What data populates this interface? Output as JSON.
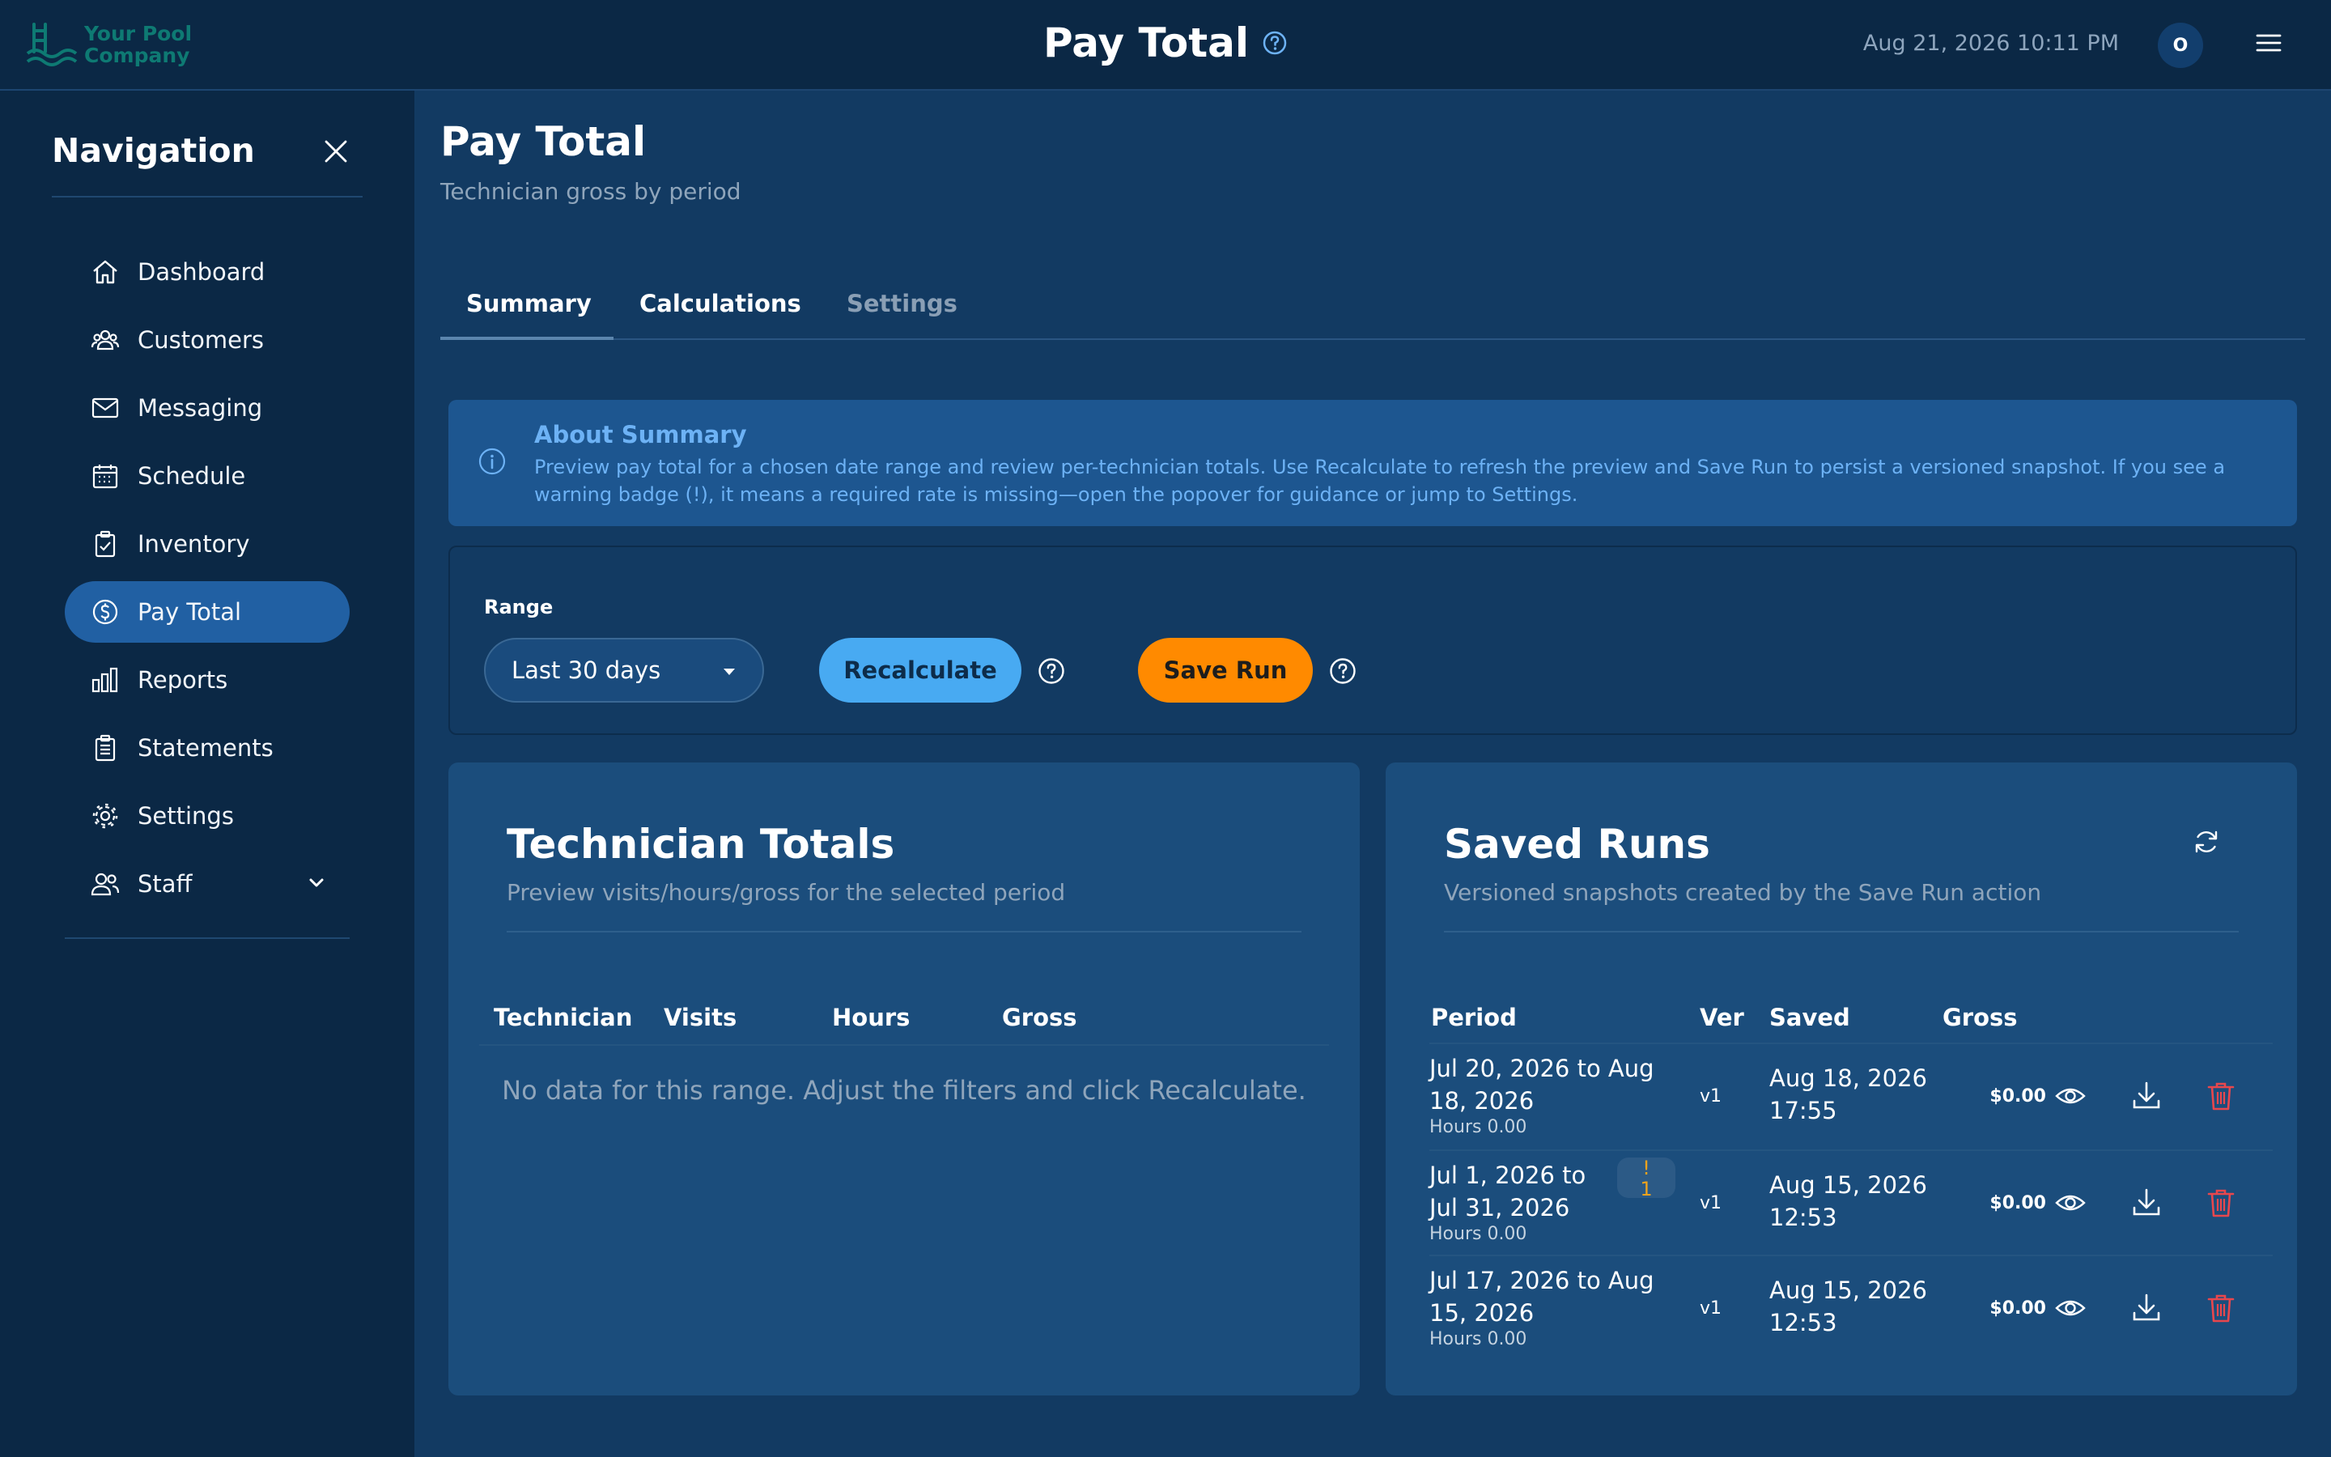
{
  "header": {
    "brand_line1": "Your Pool",
    "brand_line2": "Company",
    "title": "Pay Total",
    "datetime": "Aug 21, 2026 10:11 PM",
    "avatar_initial": "O"
  },
  "sidebar": {
    "title": "Navigation",
    "items": [
      {
        "label": "Dashboard",
        "icon": "home-icon"
      },
      {
        "label": "Customers",
        "icon": "users-icon"
      },
      {
        "label": "Messaging",
        "icon": "mail-icon"
      },
      {
        "label": "Schedule",
        "icon": "calendar-icon"
      },
      {
        "label": "Inventory",
        "icon": "clipboard-check-icon"
      },
      {
        "label": "Pay Total",
        "icon": "dollar-circle-icon",
        "active": true
      },
      {
        "label": "Reports",
        "icon": "bar-chart-icon"
      },
      {
        "label": "Statements",
        "icon": "document-icon"
      },
      {
        "label": "Settings",
        "icon": "gear-icon"
      },
      {
        "label": "Staff",
        "icon": "staff-icon"
      }
    ]
  },
  "page": {
    "title": "Pay Total",
    "subtitle": "Technician gross by period"
  },
  "tabs": [
    "Summary",
    "Calculations",
    "Settings"
  ],
  "about": {
    "title": "About Summary",
    "text": "Preview pay total for a chosen date range and review per-technician totals. Use Recalculate to refresh the preview and Save Run to persist a versioned snapshot. If you see a warning badge (!), it means a required rate is missing—open the popover for guidance or jump to Settings."
  },
  "range": {
    "label": "Range",
    "selected": "Last 30 days",
    "recalculate_label": "Recalculate",
    "save_label": "Save Run"
  },
  "technician_totals": {
    "title": "Technician Totals",
    "subtitle": "Preview visits/hours/gross for the selected period",
    "columns": [
      "Technician",
      "Visits",
      "Hours",
      "Gross"
    ],
    "empty_text": "No data for this range. Adjust the filters and click Recalculate."
  },
  "saved_runs": {
    "title": "Saved Runs",
    "subtitle": "Versioned snapshots created by the Save Run action",
    "columns": [
      "Period",
      "Ver",
      "Saved",
      "Gross"
    ],
    "rows": [
      {
        "period": "Jul 20, 2026 to Aug 18, 2026",
        "hours": "Hours 0.00",
        "ver": "v1",
        "saved": "Aug 18, 2026 17:55",
        "gross": "$0.00"
      },
      {
        "period": "Jul 1, 2026 to Jul 31, 2026",
        "hours": "Hours 0.00",
        "ver": "v1",
        "saved": "Aug 15, 2026 12:53",
        "gross": "$0.00",
        "warning": "!",
        "warning_count": "1"
      },
      {
        "period": "Jul 17, 2026 to Aug 15, 2026",
        "hours": "Hours 0.00",
        "ver": "v1",
        "saved": "Aug 15, 2026 12:53",
        "gross": "$0.00"
      }
    ]
  },
  "colors": {
    "accent": "#48aaf2",
    "save": "#ff8a00",
    "active_nav": "#2160a3",
    "delete": "#e8474d",
    "warning": "#f0a31c"
  }
}
